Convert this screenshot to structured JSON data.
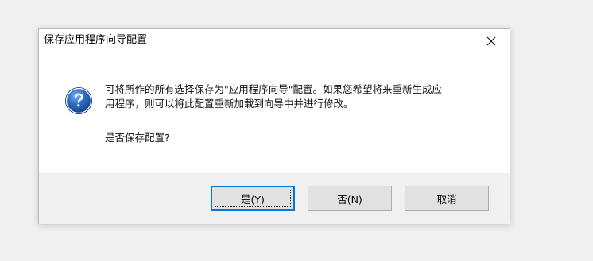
{
  "dialog": {
    "title": "保存应用程序向导配置",
    "message_lines": [
      "可将所作的所有选择保存为\"应用程序向导\"配置。如果您希望将来重新生成应",
      "用程序，则可以将此配置重新加载到向导中并进行修改。"
    ],
    "question": "是否保存配置?",
    "icon": "question-icon",
    "buttons": {
      "yes": "是(Y)",
      "no": "否(N)",
      "cancel": "取消"
    },
    "default_button": "yes"
  },
  "colors": {
    "focus_border": "#0078d7",
    "button_face": "#e1e1e1",
    "footer": "#f0f0f0",
    "icon_blue": "#1f5fae"
  }
}
